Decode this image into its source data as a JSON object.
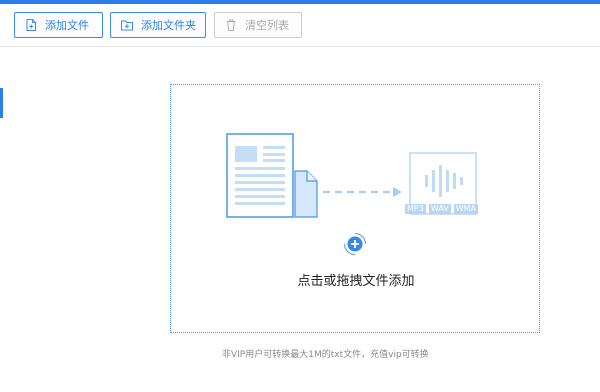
{
  "toolbar": {
    "add_file_label": "添加文件",
    "add_folder_label": "添加文件夹",
    "clear_list_label": "清空列表"
  },
  "drop_zone": {
    "prompt": "点击或拖拽文件添加",
    "output_formats": [
      "MP3",
      "WAV",
      "WMA"
    ]
  },
  "hint": "非VIP用户可转换最大1M的txt文件，充值vip可转换"
}
